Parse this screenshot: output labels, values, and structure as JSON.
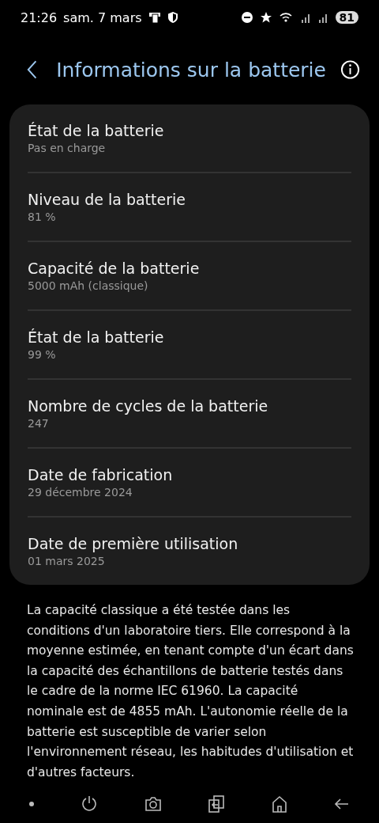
{
  "status_bar": {
    "time": "21:26",
    "date": "sam. 7 mars",
    "battery": "81"
  },
  "header": {
    "title": "Informations sur la batterie"
  },
  "items": [
    {
      "title": "État de la batterie",
      "value": "Pas en charge"
    },
    {
      "title": "Niveau de la batterie",
      "value": "81 %"
    },
    {
      "title": "Capacité de la batterie",
      "value": "5000 mAh (classique)"
    },
    {
      "title": "État de la batterie",
      "value": "99 %"
    },
    {
      "title": "Nombre de cycles de la batterie",
      "value": "247"
    },
    {
      "title": "Date de fabrication",
      "value": "29 décembre 2024"
    },
    {
      "title": "Date de première utilisation",
      "value": "01 mars 2025"
    }
  ],
  "note": "La capacité classique a été testée dans les conditions d'un laboratoire tiers. Elle correspond à la moyenne estimée, en tenant compte d'un écart dans la capacité des échantillons de batterie testés dans le cadre de la norme IEC 61960. La capacité nominale est de 4855 mAh. L'autonomie réelle de la batterie est susceptible de varier selon l'environnement réseau, les habitudes d'utilisation et d'autres facteurs.",
  "nav_bar": [
    {
      "kind": "dot"
    },
    {
      "kind": "power"
    },
    {
      "kind": "camera"
    },
    {
      "kind": "switch"
    },
    {
      "kind": "home"
    },
    {
      "kind": "back"
    }
  ]
}
